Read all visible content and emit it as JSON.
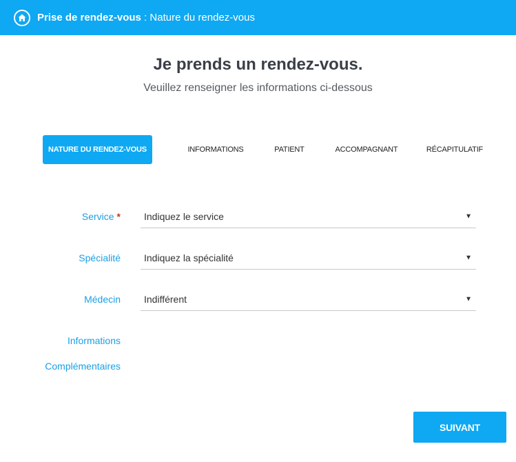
{
  "header": {
    "title_strong": "Prise de rendez-vous",
    "title_rest": " : Nature du rendez-vous",
    "icon": "home-icon"
  },
  "main": {
    "heading": "Je prends un rendez-vous.",
    "subheading": "Veuillez renseigner les informations ci-dessous"
  },
  "steps": [
    {
      "label": "NATURE DU RENDEZ-VOUS",
      "active": true
    },
    {
      "label": "INFORMATIONS",
      "active": false
    },
    {
      "label": "PATIENT",
      "active": false
    },
    {
      "label": "ACCOMPAGNANT",
      "active": false
    },
    {
      "label": "RÉCAPITULATIF",
      "active": false
    }
  ],
  "form": {
    "service": {
      "label": "Service",
      "required_mark": "*",
      "value": "Indiquez le service"
    },
    "specialite": {
      "label": "Spécialité",
      "value": "Indiquez la spécialité"
    },
    "medecin": {
      "label": "Médecin",
      "value": "Indifférent"
    },
    "info_line1": "Informations",
    "info_line2": "Complémentaires",
    "caret": "▼"
  },
  "actions": {
    "next_label": "SUIVANT"
  },
  "colors": {
    "accent": "#0fa8f2",
    "label": "#1a9fe4",
    "required": "#c0392b"
  }
}
